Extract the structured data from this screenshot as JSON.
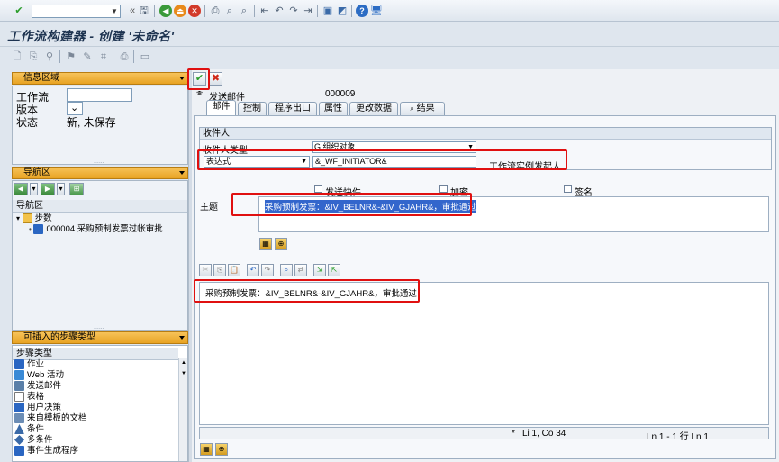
{
  "window": {
    "title": "工作流构建器 - 创建 '未命名'"
  },
  "system_toolbar": {
    "command_field_value": ""
  },
  "info_area": {
    "header": "信息区域",
    "workflow_label": "工作流",
    "workflow_value": "",
    "version_label": "版本",
    "version_value": "",
    "status_label": "状态",
    "status_value": "新, 未保存"
  },
  "nav_area": {
    "header": "导航区",
    "tree_header": "导航区",
    "items": [
      {
        "label": "步数",
        "type": "folder"
      },
      {
        "label": "000004 采购预制发票过帐审批",
        "type": "step"
      }
    ]
  },
  "step_types": {
    "header": "可插入的步骤类型",
    "list_header": "步骤类型",
    "items": [
      {
        "label": "作业",
        "icon": "activity-icon"
      },
      {
        "label": "Web 活动",
        "icon": "web-activity-icon"
      },
      {
        "label": "发送邮件",
        "icon": "send-mail-icon"
      },
      {
        "label": "表格",
        "icon": "form-icon"
      },
      {
        "label": "用户决策",
        "icon": "user-decision-icon"
      },
      {
        "label": "来自模板的文档",
        "icon": "document-template-icon"
      },
      {
        "label": "条件",
        "icon": "condition-icon"
      },
      {
        "label": "多条件",
        "icon": "multiple-condition-icon"
      },
      {
        "label": "事件生成程序",
        "icon": "event-creator-icon"
      }
    ]
  },
  "step": {
    "type_label": "发送邮件",
    "number": "000009"
  },
  "tabs": [
    {
      "label": "邮件",
      "active": true
    },
    {
      "label": "控制",
      "active": false
    },
    {
      "label": "程序出口",
      "active": false
    },
    {
      "label": "属性",
      "active": false
    },
    {
      "label": "更改数据",
      "active": false
    },
    {
      "label": "结果",
      "active": false
    }
  ],
  "mail": {
    "recipient_group": "收件人",
    "recipient_type_label": "收件人类型",
    "recipient_type_value": "G 组织对象",
    "expression_select": "表达式",
    "expression_value": "&_WF_INITIATOR&",
    "expression_desc": "工作流实例发起人",
    "send_express_label": "发送快件",
    "encrypt_label": "加密",
    "signature_label": "签名",
    "subject_label": "主题",
    "subject_value": "采购预制发票：&IV_BELNR&-&IV_GJAHR&，审批通过",
    "body_value": "采购预制发票：&IV_BELNR&-&IV_GJAHR&，审批通过",
    "status_star": "*",
    "cursor_pos": "Li 1, Co 34",
    "line_range": "Ln 1 - 1 行 Ln 1"
  },
  "colors": {
    "panel_header": "#e8a323",
    "highlight_box": "#e01010",
    "selection": "#3366cc"
  }
}
